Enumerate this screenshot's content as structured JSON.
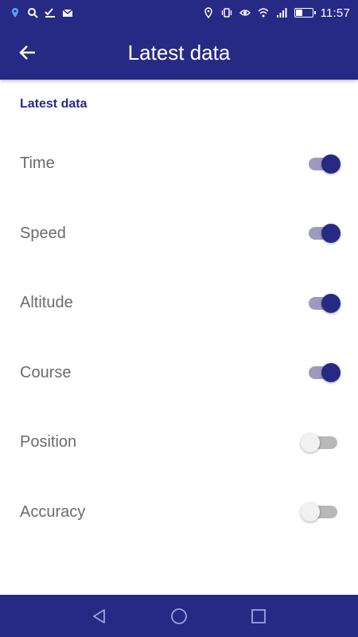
{
  "status_bar": {
    "left_icons": [
      "location-pin-icon",
      "search-icon",
      "check-icon",
      "mail-icon"
    ],
    "right_icons": [
      "location-icon",
      "vibrate-icon",
      "eye-icon",
      "wifi-icon",
      "signal-icon",
      "battery-icon"
    ],
    "battery_level": 0.45,
    "time": "11:57"
  },
  "app_bar": {
    "back_icon": "back-arrow-icon",
    "title": "Latest data"
  },
  "section": {
    "header": "Latest data",
    "items": [
      {
        "label": "Time",
        "enabled": true
      },
      {
        "label": "Speed",
        "enabled": true
      },
      {
        "label": "Altitude",
        "enabled": true
      },
      {
        "label": "Course",
        "enabled": true
      },
      {
        "label": "Position",
        "enabled": false
      },
      {
        "label": "Accuracy",
        "enabled": false
      }
    ]
  },
  "nav_bar": {
    "buttons": [
      "back-triangle-icon",
      "home-circle-icon",
      "recents-square-icon"
    ]
  },
  "colors": {
    "primary": "#272a84",
    "switch_on_track": "#9c9bbf",
    "switch_off_track": "#b8b8b8",
    "label_text": "#6b6b6b"
  }
}
